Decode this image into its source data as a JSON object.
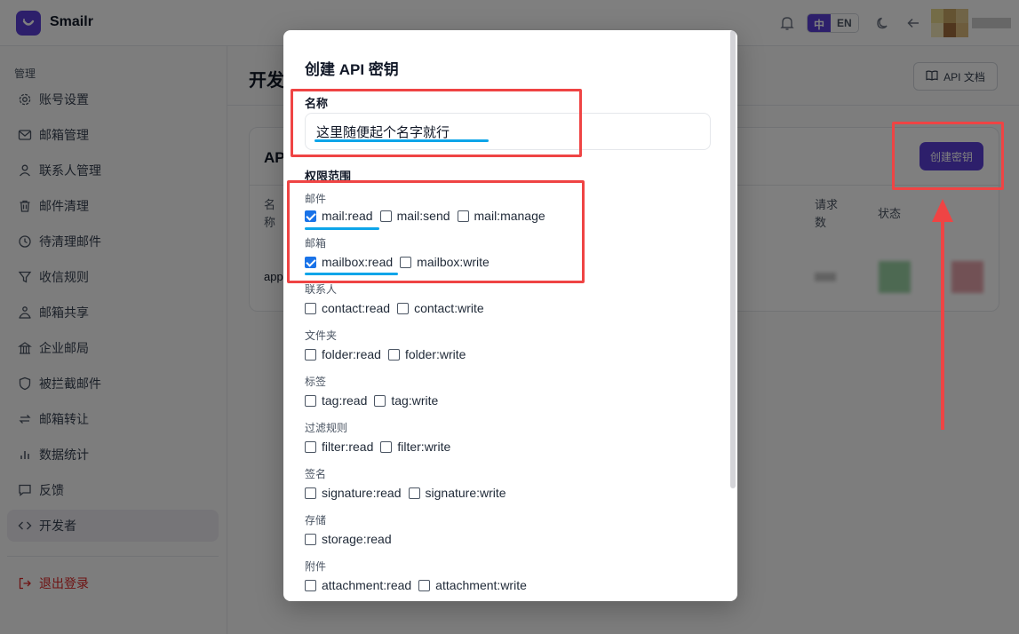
{
  "app": {
    "brand": "Smailr"
  },
  "header": {
    "lang_zh": "中",
    "lang_en": "EN"
  },
  "sidebar": {
    "section": "管理",
    "items": [
      {
        "label": "账号设置",
        "icon": "gear-icon"
      },
      {
        "label": "邮箱管理",
        "icon": "mail-icon"
      },
      {
        "label": "联系人管理",
        "icon": "user-icon"
      },
      {
        "label": "邮件清理",
        "icon": "trash-icon"
      },
      {
        "label": "待清理邮件",
        "icon": "clock-icon"
      },
      {
        "label": "收信规则",
        "icon": "filter-icon"
      },
      {
        "label": "邮箱共享",
        "icon": "share-icon"
      },
      {
        "label": "企业邮局",
        "icon": "building-icon"
      },
      {
        "label": "被拦截邮件",
        "icon": "shield-icon"
      },
      {
        "label": "邮箱转让",
        "icon": "transfer-icon"
      },
      {
        "label": "数据统计",
        "icon": "chart-icon"
      },
      {
        "label": "反馈",
        "icon": "message-icon"
      },
      {
        "label": "开发者",
        "icon": "code-icon"
      }
    ],
    "logout": "退出登录"
  },
  "main": {
    "title": "开发",
    "docs_button": "API 文档",
    "card_title": "AP",
    "create_button": "创建密钥",
    "col_name": "名\n称",
    "col_requests": "请求\n数",
    "col_status": "状态",
    "row_name": "app"
  },
  "modal": {
    "title": "创建 API 密钥",
    "name_label": "名称",
    "name_value": "这里随便起个名字就行",
    "scope_label": "权限范围",
    "groups": [
      {
        "label": "邮件",
        "perms": [
          {
            "name": "mail:read",
            "checked": true
          },
          {
            "name": "mail:send",
            "checked": false
          },
          {
            "name": "mail:manage",
            "checked": false
          }
        ]
      },
      {
        "label": "邮箱",
        "perms": [
          {
            "name": "mailbox:read",
            "checked": true
          },
          {
            "name": "mailbox:write",
            "checked": false
          }
        ]
      },
      {
        "label": "联系人",
        "perms": [
          {
            "name": "contact:read",
            "checked": false
          },
          {
            "name": "contact:write",
            "checked": false
          }
        ]
      },
      {
        "label": "文件夹",
        "perms": [
          {
            "name": "folder:read",
            "checked": false
          },
          {
            "name": "folder:write",
            "checked": false
          }
        ]
      },
      {
        "label": "标签",
        "perms": [
          {
            "name": "tag:read",
            "checked": false
          },
          {
            "name": "tag:write",
            "checked": false
          }
        ]
      },
      {
        "label": "过滤规则",
        "perms": [
          {
            "name": "filter:read",
            "checked": false
          },
          {
            "name": "filter:write",
            "checked": false
          }
        ]
      },
      {
        "label": "签名",
        "perms": [
          {
            "name": "signature:read",
            "checked": false
          },
          {
            "name": "signature:write",
            "checked": false
          }
        ]
      },
      {
        "label": "存储",
        "perms": [
          {
            "name": "storage:read",
            "checked": false
          }
        ]
      },
      {
        "label": "附件",
        "perms": [
          {
            "name": "attachment:read",
            "checked": false
          },
          {
            "name": "attachment:write",
            "checked": false
          }
        ]
      }
    ]
  },
  "colors": {
    "accent": "#5b3fd6",
    "annotation_red": "#ef4444",
    "annotation_blue": "#0ea5e9",
    "checkbox_checked": "#1a73e8"
  }
}
